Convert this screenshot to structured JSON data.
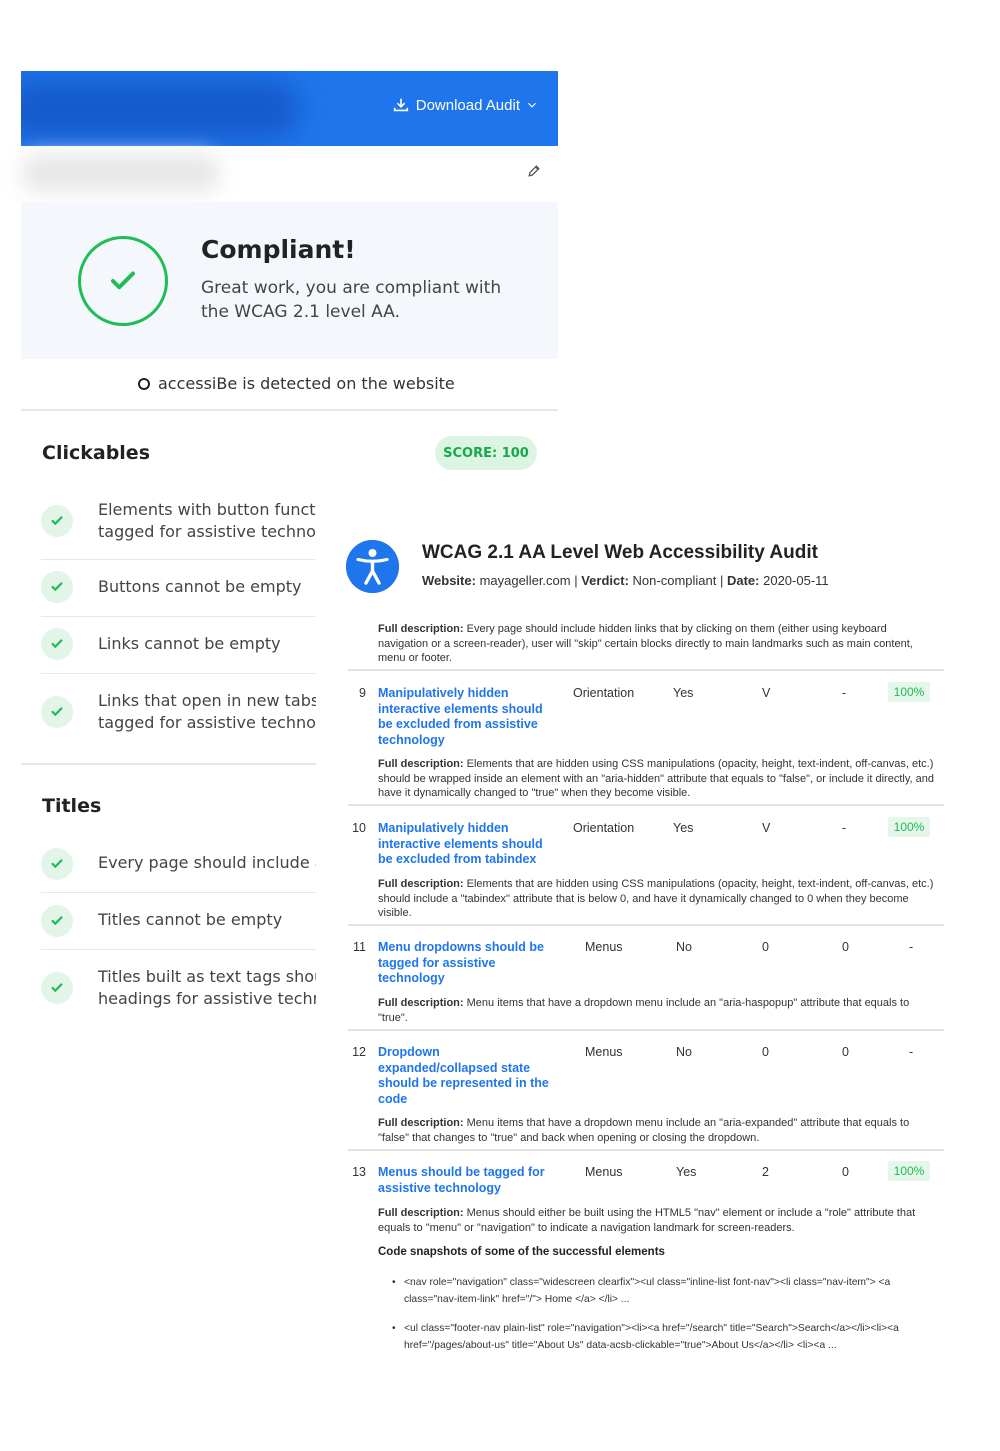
{
  "widget": {
    "download_label": "Download Audit",
    "compliant_title": "Compliant!",
    "compliant_text": "Great work, you are compliant with the WCAG 2.1 level AA.",
    "detected_text": "accessiBe is detected on the website",
    "sections": [
      {
        "title": "Clickables",
        "score": "SCORE: 100",
        "items": [
          {
            "line1": "Elements with button functi",
            "line2": "tagged for assistive technolo"
          },
          {
            "line1": "Buttons cannot be empty",
            "line2": ""
          },
          {
            "line1": "Links cannot be empty",
            "line2": ""
          },
          {
            "line1": "Links that open in new tabs/",
            "line2": "tagged for assistive technolo"
          }
        ]
      },
      {
        "title": "Titles",
        "items": [
          {
            "line1": "Every page should include a",
            "line2": ""
          },
          {
            "line1": "Titles cannot be empty",
            "line2": ""
          },
          {
            "line1": "Titles built as text tags shou",
            "line2": "headings for assistive techn"
          }
        ]
      }
    ],
    "colors": {
      "brand_blue": "#1f76ec",
      "success_green": "#1fbd55"
    }
  },
  "report": {
    "title": "WCAG 2.1 AA Level Web Accessibility Audit",
    "meta_website_label": "Website:",
    "meta_website": "mayageller.com",
    "meta_verdict_label": "Verdict:",
    "meta_verdict": "Non-compliant",
    "meta_date_label": "Date:",
    "meta_date": "2020-05-11",
    "desc_label": "Full description:",
    "intro_desc": "Every page should include hidden links that by clicking on them (either using keyboard navigation or a screen-reader), user will \"skip\" certain blocks directly to main landmarks such as main content, menu or footer.",
    "rows": [
      {
        "num": "9",
        "name": "Manipulatively hidden interactive elements should be excluded from assistive technology",
        "category": "Orientation",
        "c3": "Yes",
        "c4": "V",
        "c5": "-",
        "result": "100%",
        "desc": "Elements that are hidden using CSS manipulations (opacity, height, text-indent, off-canvas, etc.) should be wrapped inside an element with an \"aria-hidden\" attribute that equals to \"false\", or include it directly, and have it dynamically changed to \"true\" when they become visible."
      },
      {
        "num": "10",
        "name": "Manipulatively hidden interactive elements should be excluded from tabindex",
        "category": "Orientation",
        "c3": "Yes",
        "c4": "V",
        "c5": "-",
        "result": "100%",
        "desc": "Elements that are hidden using CSS manipulations (opacity, height, text-indent, off-canvas, etc.) should include a \"tabindex\" attribute that is below 0, and have it dynamically changed to 0 when they become visible."
      },
      {
        "num": "11",
        "name": "Menu dropdowns should be tagged for assistive technology",
        "category": "Menus",
        "c3": "No",
        "c4": "0",
        "c5": "0",
        "result": "-",
        "desc": "Menu items that have a dropdown menu include an \"aria-haspopup\" attribute that equals to \"true\"."
      },
      {
        "num": "12",
        "name": "Dropdown expanded/collapsed state should be represented in the code",
        "category": "Menus",
        "c3": "No",
        "c4": "0",
        "c5": "0",
        "result": "-",
        "desc": "Menu items that have a dropdown menu include an \"aria-expanded\" attribute that equals to \"false\" that changes to \"true\" and back when opening or closing the dropdown."
      },
      {
        "num": "13",
        "name": "Menus should be tagged for assistive technology",
        "category": "Menus",
        "c3": "Yes",
        "c4": "2",
        "c5": "0",
        "result": "100%",
        "desc": "Menus should either be built using the HTML5 \"nav\" element or include a \"role\" attribute that equals to \"menu\" or \"navigation\" to indicate a navigation landmark for screen-readers."
      }
    ],
    "snapshots_title": "Code snapshots of some of the successful elements",
    "snapshots": [
      "<nav role=\"navigation\" class=\"widescreen clearfix\"><ul class=\"inline-list font-nav\"><li class=\"nav-item\"> <a class=\"nav-item-link\" href=\"/\"> Home </a> </li> ...",
      "<ul class=\"footer-nav plain-list\" role=\"navigation\"><li><a href=\"/search\" title=\"Search\">Search</a></li><li><a href=\"/pages/about-us\" title=\"About Us\" data-acsb-clickable=\"true\">About Us</a></li> <li><a ..."
    ]
  }
}
